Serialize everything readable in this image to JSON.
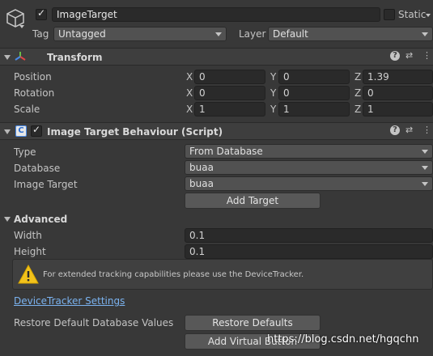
{
  "object": {
    "name": "ImageTarget",
    "active": true,
    "static_label": "Static",
    "static_checked": false,
    "tag_label": "Tag",
    "tag_value": "Untagged",
    "layer_label": "Layer",
    "layer_value": "Default"
  },
  "transform": {
    "title": "Transform",
    "rows": [
      {
        "label": "Position",
        "x": "0",
        "y": "0",
        "z": "1.39"
      },
      {
        "label": "Rotation",
        "x": "0",
        "y": "0",
        "z": "0"
      },
      {
        "label": "Scale",
        "x": "1",
        "y": "1",
        "z": "1"
      }
    ],
    "axis_x": "X",
    "axis_y": "Y",
    "axis_z": "Z"
  },
  "behaviour": {
    "title": "Image Target Behaviour (Script)",
    "enabled": true,
    "type_label": "Type",
    "type_value": "From Database",
    "database_label": "Database",
    "database_value": "buaa",
    "image_target_label": "Image Target",
    "image_target_value": "buaa",
    "add_target_button": "Add Target"
  },
  "advanced": {
    "title": "Advanced",
    "width_label": "Width",
    "width_value": "0.1",
    "height_label": "Height",
    "height_value": "0.1",
    "warning_text": "For extended tracking capabilities please use the DeviceTracker.",
    "device_tracker_link": "DeviceTracker Settings",
    "restore_label": "Restore Default Database Values",
    "restore_button": "Restore Defaults",
    "virtual_button": "Add Virtual Button"
  },
  "watermark": "https://blog.csdn.net/hgqchn",
  "icons": {
    "help": "?",
    "settings": "⇄",
    "menu": "⋮"
  }
}
